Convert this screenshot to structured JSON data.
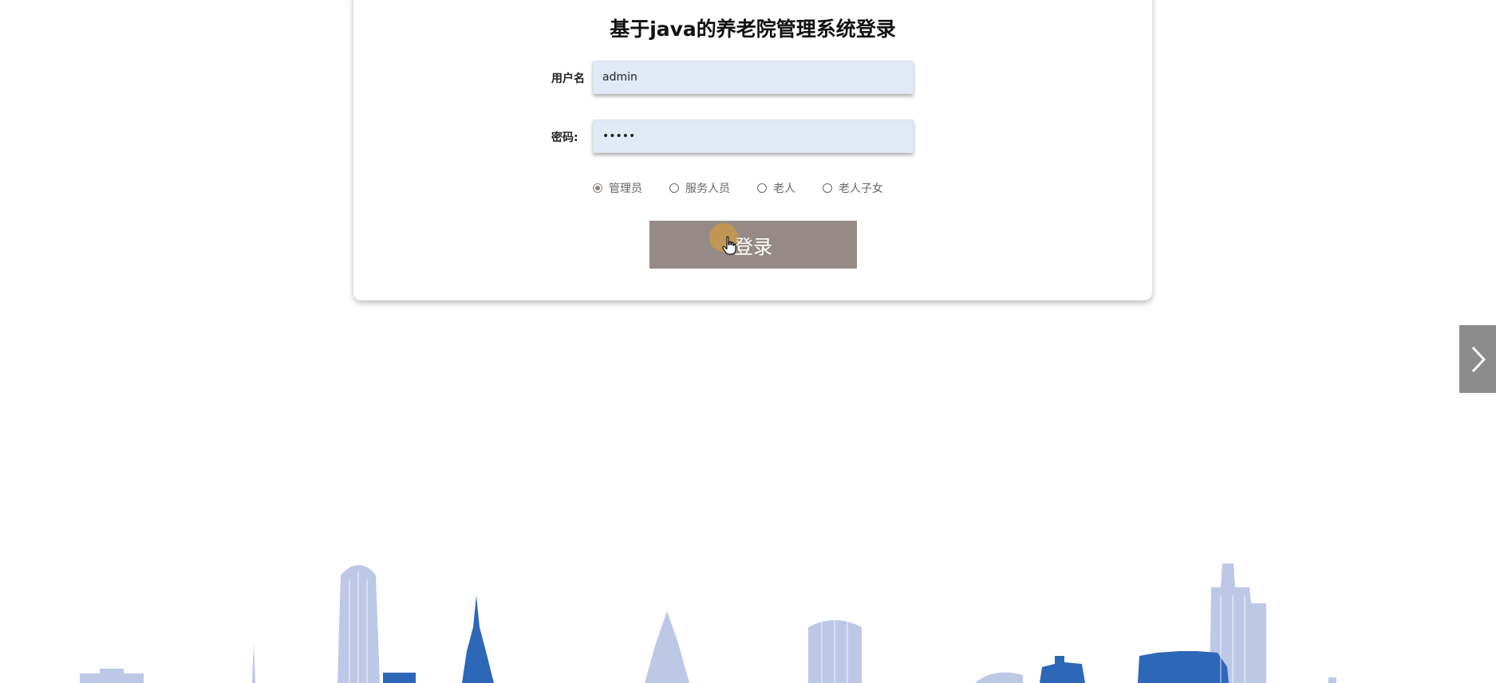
{
  "login": {
    "title": "基于java的养老院管理系统登录",
    "username_label": "用户名",
    "username_value": "admin",
    "password_label": "密码:",
    "password_value": "admin",
    "roles": [
      {
        "label": "管理员",
        "selected": true
      },
      {
        "label": "服务人员",
        "selected": false
      },
      {
        "label": "老人",
        "selected": false
      },
      {
        "label": "老人子女",
        "selected": false
      }
    ],
    "submit_label": "登录"
  },
  "carousel": {
    "next_icon": "chevron-right-icon"
  },
  "colors": {
    "button": "#958a85",
    "input_bg": "#e1e9f6",
    "skyline_light": "#b8c5e3",
    "skyline_dark": "#2d67b8"
  }
}
